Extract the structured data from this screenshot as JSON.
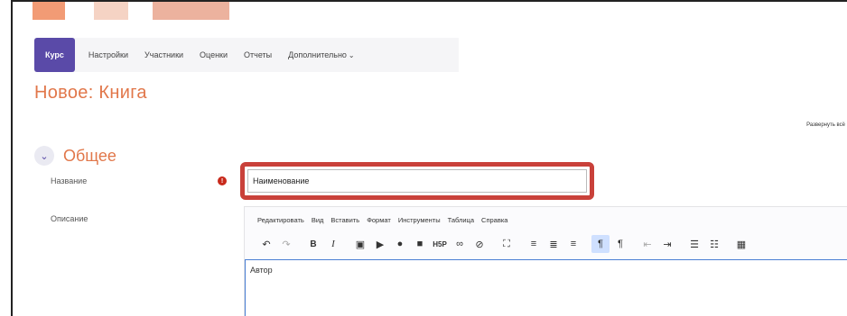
{
  "header": {
    "nav_tabs": [
      {
        "label": "Курс",
        "active": true
      },
      {
        "label": "Настройки",
        "active": false
      },
      {
        "label": "Участники",
        "active": false
      },
      {
        "label": "Оценки",
        "active": false
      },
      {
        "label": "Отчеты",
        "active": false
      },
      {
        "label": "Дополнительно",
        "active": false
      }
    ]
  },
  "page": {
    "title": "Новое: Книга",
    "expand_all": "Развернуть всё"
  },
  "section": {
    "title": "Общее"
  },
  "form": {
    "name_label": "Название",
    "name_value": "Наименование",
    "description_label": "Описание"
  },
  "editor": {
    "menu": [
      "Редактировать",
      "Вид",
      "Вставить",
      "Формат",
      "Инструменты",
      "Таблица",
      "Справка"
    ],
    "content": "Автор",
    "h5p_label": "H5P"
  },
  "colors": {
    "accent": "#5a4aa8",
    "title": "#e1774a",
    "highlight_outline": "#c9413a",
    "required": "#c8291b"
  }
}
